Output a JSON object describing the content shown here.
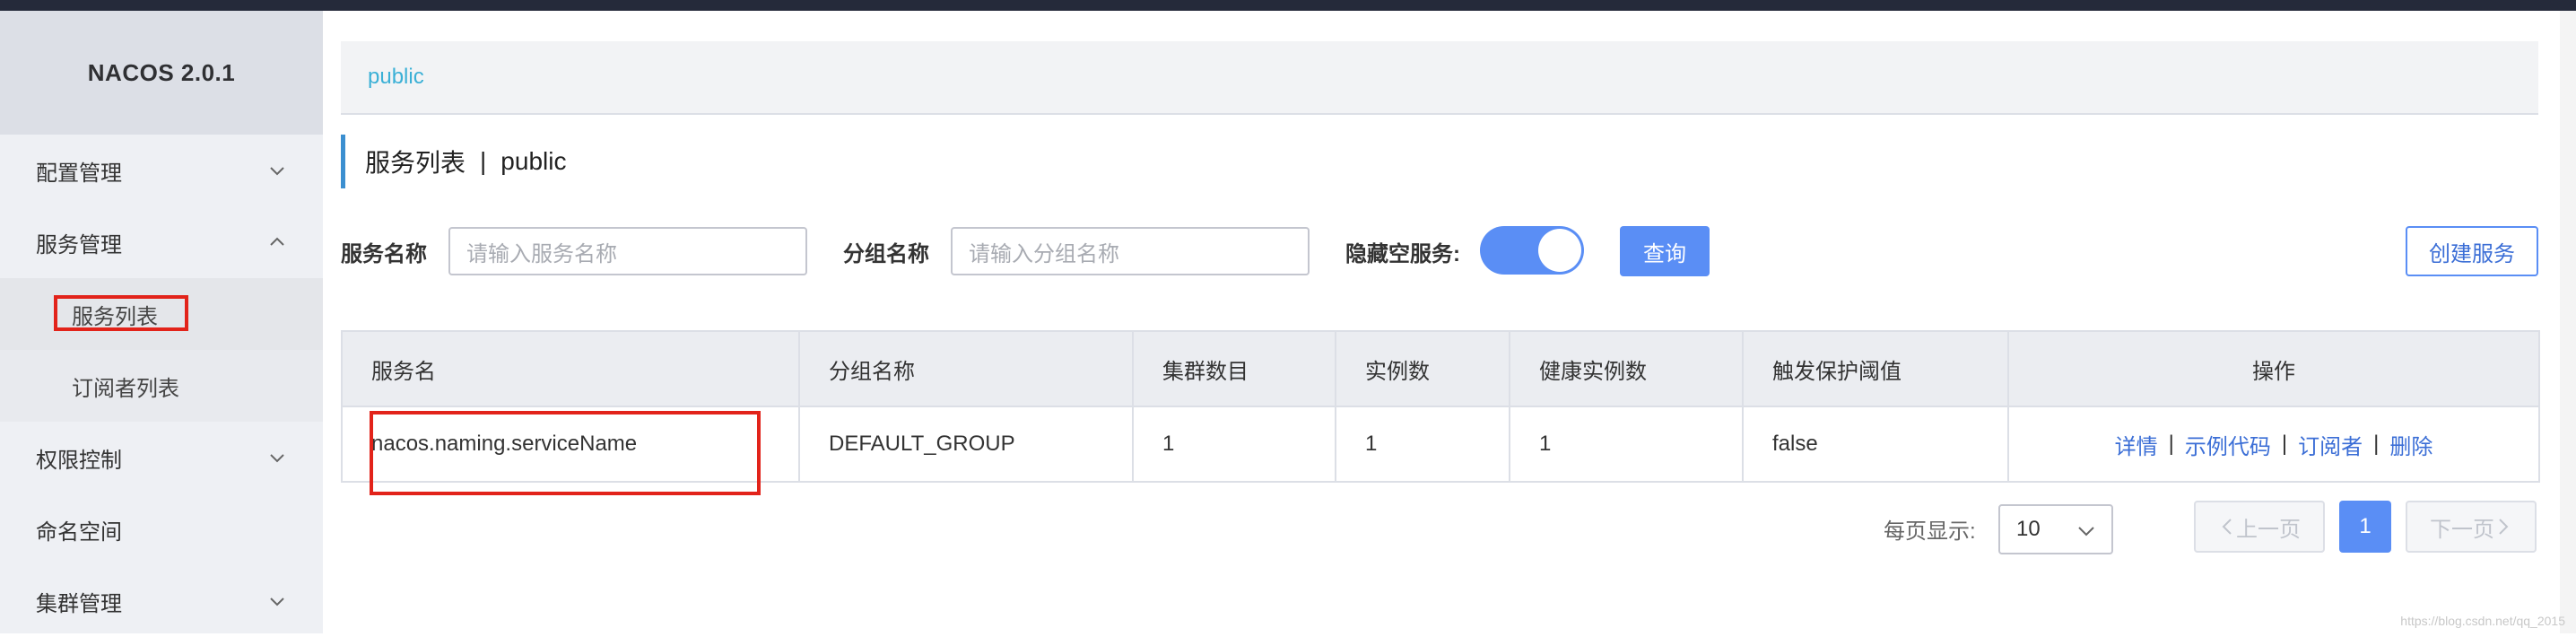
{
  "brand": "NACOS 2.0.1",
  "sidebar": {
    "items": [
      {
        "label": "配置管理"
      },
      {
        "label": "服务管理"
      },
      {
        "label": "权限控制"
      },
      {
        "label": "命名空间"
      },
      {
        "label": "集群管理"
      }
    ],
    "sub_items": [
      {
        "label": "服务列表"
      },
      {
        "label": "订阅者列表"
      }
    ]
  },
  "namespace_bar": {
    "label": "public"
  },
  "page_title": {
    "title": "服务列表",
    "separator": "|",
    "namespace": "public"
  },
  "search": {
    "service_name_label": "服务名称",
    "service_name_placeholder": "请输入服务名称",
    "group_name_label": "分组名称",
    "group_name_placeholder": "请输入分组名称",
    "hide_empty_label": "隐藏空服务:",
    "hide_empty_on": true,
    "query_button": "查询",
    "create_button": "创建服务"
  },
  "table": {
    "columns": [
      "服务名",
      "分组名称",
      "集群数目",
      "实例数",
      "健康实例数",
      "触发保护阈值",
      "操作"
    ],
    "rows": [
      {
        "service": "nacos.naming.serviceName",
        "group": "DEFAULT_GROUP",
        "clusters": "1",
        "instances": "1",
        "healthy": "1",
        "threshold": "false",
        "ops": [
          "详情",
          "示例代码",
          "订阅者",
          "删除"
        ]
      }
    ],
    "op_separator": "|"
  },
  "pagination": {
    "page_size_label": "每页显示:",
    "page_size": "10",
    "prev": "上一页",
    "current": "1",
    "next": "下一页"
  },
  "watermark": "https://blog.csdn.net/qq_2015",
  "colors": {
    "primary": "#5a8ef5",
    "highlight": "#e2231a",
    "link": "#3b6ed6"
  }
}
